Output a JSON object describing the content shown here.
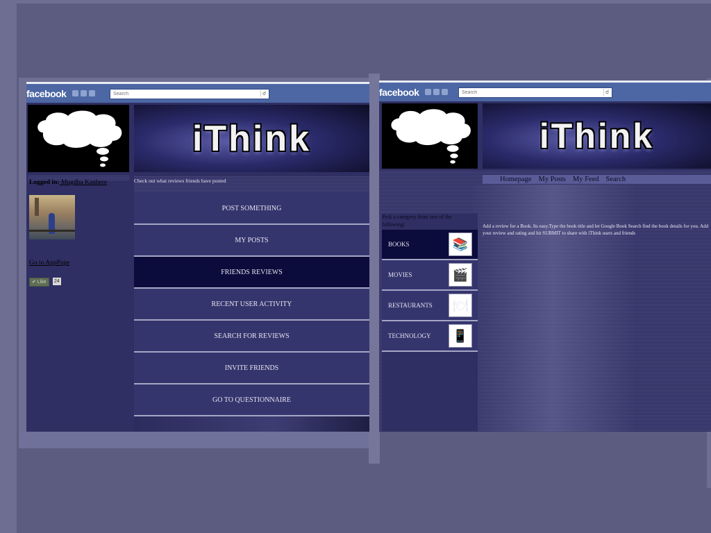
{
  "left_slide": {
    "facebook": {
      "logo": "facebook",
      "search_placeholder": "Search",
      "search_icon": "magnifier-icon"
    },
    "banner": {
      "title": "iThink"
    },
    "caption": "Check out what reviews friends have posted",
    "logged_in_label": "Logged in:",
    "logged_in_user": " Mugdha Kanhere",
    "go_to_app": "Go to AppPage",
    "like_label": "✔ Like",
    "like_count": "24",
    "menu": [
      {
        "label": "POST SOMETHING",
        "active": false
      },
      {
        "label": "MY POSTS",
        "active": false
      },
      {
        "label": "FRIENDS REVIEWS",
        "active": true
      },
      {
        "label": "RECENT USER ACTIVITY",
        "active": false
      },
      {
        "label": "SEARCH FOR REVIEWS",
        "active": false
      },
      {
        "label": "INVITE FRIENDS",
        "active": false
      },
      {
        "label": "GO TO QUESTIONNAIRE",
        "active": false
      }
    ]
  },
  "right_slide": {
    "facebook": {
      "logo": "facebook",
      "search_placeholder": "Search",
      "search_icon": "magnifier-icon"
    },
    "banner": {
      "title": "iThink"
    },
    "nav": [
      "Homepage",
      "My Posts",
      "My Feed",
      "Search"
    ],
    "category_prompt": "Pick a category from one of the following:",
    "categories": [
      {
        "label": "BOOKS",
        "icon": "books-icon",
        "glyph": "📚",
        "active": true
      },
      {
        "label": "MOVIES",
        "icon": "film-reel-icon",
        "glyph": "🎬",
        "active": false
      },
      {
        "label": "RESTAURANTS",
        "icon": "restaurant-icon",
        "glyph": "🍽",
        "active": false
      },
      {
        "label": "TECHNOLOGY",
        "icon": "mobile-phone-icon",
        "glyph": "📱",
        "active": false
      }
    ],
    "review_note": "Add a review for a Book. Its easy.Type the book title and let Google Book Search find the book details for you. Add your review and rating and hit SUBMIT to share with iThink users and friends"
  },
  "colors": {
    "background": "#5b5c80",
    "panel": "#2f2f63",
    "facebook_bar": "#4c67a3",
    "active_item": "#0b0b3c"
  }
}
